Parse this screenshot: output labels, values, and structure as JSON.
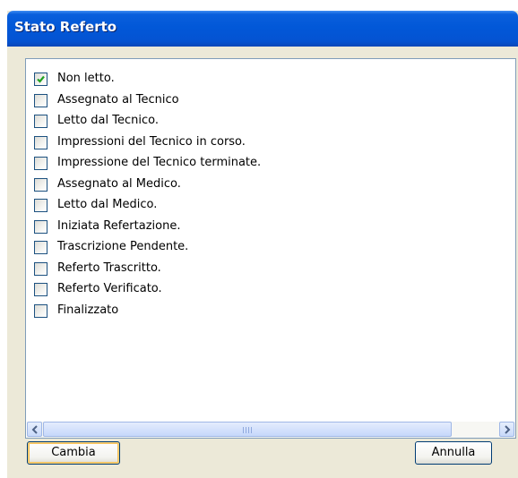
{
  "window": {
    "title": "Stato Referto"
  },
  "status_list": {
    "items": [
      {
        "label": "Non letto.",
        "checked": true
      },
      {
        "label": "Assegnato al Tecnico",
        "checked": false
      },
      {
        "label": "Letto dal Tecnico.",
        "checked": false
      },
      {
        "label": "Impressioni del Tecnico in corso.",
        "checked": false
      },
      {
        "label": "Impressione del Tecnico terminate.",
        "checked": false
      },
      {
        "label": "Assegnato al Medico.",
        "checked": false
      },
      {
        "label": "Letto dal Medico.",
        "checked": false
      },
      {
        "label": "Iniziata Refertazione.",
        "checked": false
      },
      {
        "label": "Trascrizione Pendente.",
        "checked": false
      },
      {
        "label": "Referto Trascritto.",
        "checked": false
      },
      {
        "label": "Referto Verificato.",
        "checked": false
      },
      {
        "label": "Finalizzato",
        "checked": false
      }
    ]
  },
  "buttons": {
    "change_label": "Cambia",
    "cancel_label": "Annulla"
  },
  "colors": {
    "title_bar": "#0258d8",
    "check_mark": "#21a121",
    "dialog_bg": "#ece9d8"
  }
}
